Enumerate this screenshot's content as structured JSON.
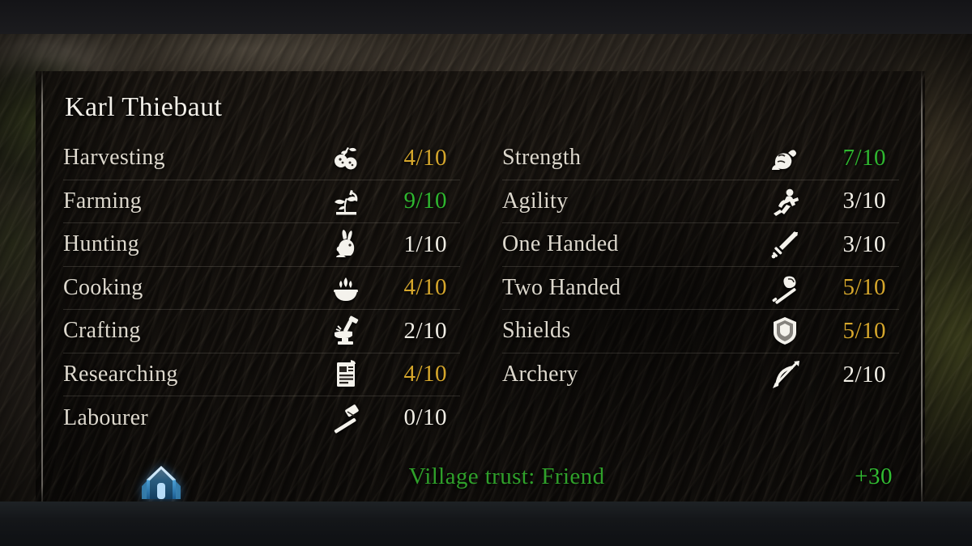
{
  "character": {
    "name": "Karl Thiebaut"
  },
  "skills_left": [
    {
      "label": "Harvesting",
      "value": "4/10",
      "tier": "gold",
      "icon": "berries-icon"
    },
    {
      "label": "Farming",
      "value": "9/10",
      "tier": "green",
      "icon": "plant-sickle-icon"
    },
    {
      "label": "Hunting",
      "value": "1/10",
      "tier": "white",
      "icon": "rabbit-icon"
    },
    {
      "label": "Cooking",
      "value": "4/10",
      "tier": "gold",
      "icon": "cooking-pot-icon"
    },
    {
      "label": "Crafting",
      "value": "2/10",
      "tier": "white",
      "icon": "anvil-hammer-icon"
    },
    {
      "label": "Researching",
      "value": "4/10",
      "tier": "gold",
      "icon": "scroll-document-icon"
    },
    {
      "label": "Labourer",
      "value": "0/10",
      "tier": "white",
      "icon": "sledgehammer-icon"
    }
  ],
  "skills_right": [
    {
      "label": "Strength",
      "value": "7/10",
      "tier": "green",
      "icon": "flexed-arm-icon"
    },
    {
      "label": "Agility",
      "value": "3/10",
      "tier": "white",
      "icon": "running-man-icon"
    },
    {
      "label": "One Handed",
      "value": "3/10",
      "tier": "white",
      "icon": "sword-icon"
    },
    {
      "label": "Two Handed",
      "value": "5/10",
      "tier": "gold",
      "icon": "battle-axe-icon"
    },
    {
      "label": "Shields",
      "value": "5/10",
      "tier": "gold",
      "icon": "shield-icon"
    },
    {
      "label": "Archery",
      "value": "2/10",
      "tier": "white",
      "icon": "bow-arrow-icon"
    }
  ],
  "trust": {
    "icon": "village-crest-icon",
    "label": "Village trust: Friend",
    "delta": "+30"
  },
  "colors": {
    "value_white": "#f2efe6",
    "value_gold": "#d6a72c",
    "value_green": "#2fb72f",
    "trust_green": "#2fa02a",
    "skill_name": "#ddd8cd",
    "panel_bg": "#151110"
  }
}
